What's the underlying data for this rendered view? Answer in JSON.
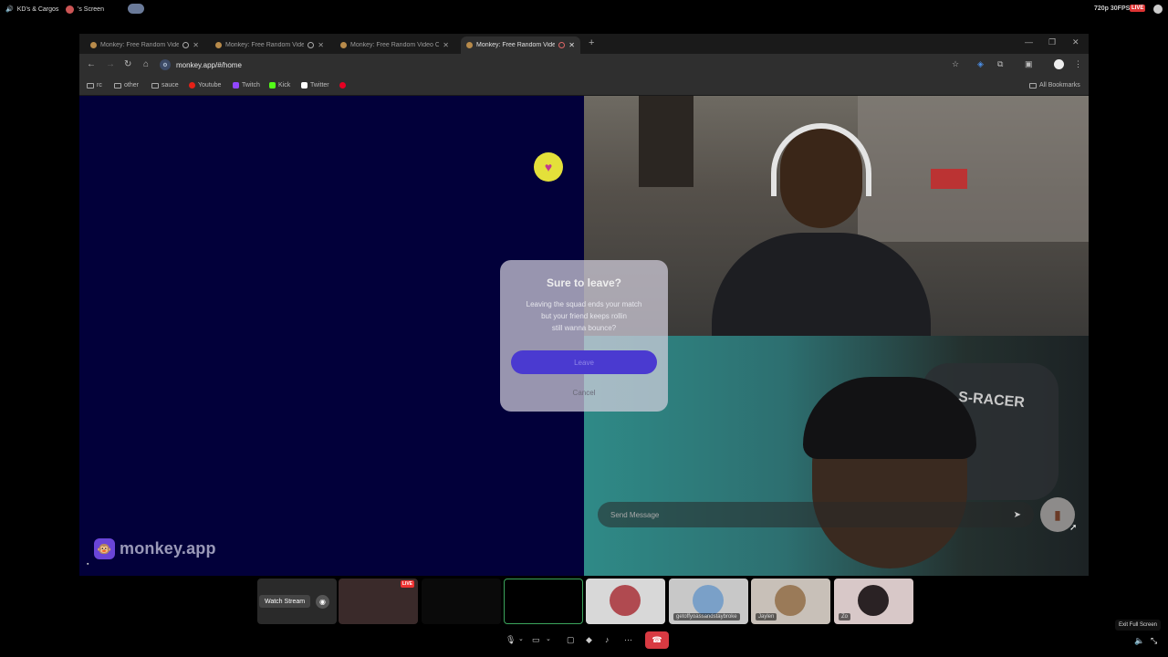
{
  "discord_top": {
    "channel": "KD's & Cargos",
    "screen_label": "'s Screen",
    "quality": "720p 30FPS",
    "live_badge": "LIVE"
  },
  "browser": {
    "tabs": [
      {
        "title": "Monkey: Free Random Video",
        "active": false
      },
      {
        "title": "Monkey: Free Random Video",
        "active": false
      },
      {
        "title": "Monkey: Free Random Video C",
        "active": false
      },
      {
        "title": "Monkey: Free Random Video",
        "active": true
      }
    ],
    "url": "monkey.app/#/home",
    "bookmarks": [
      {
        "label": "rc",
        "icon": "folder-icon"
      },
      {
        "label": "other",
        "icon": "folder-icon"
      },
      {
        "label": "sauce",
        "icon": "folder-icon"
      },
      {
        "label": "Youtube",
        "icon": "youtube-icon",
        "color": "#e62117"
      },
      {
        "label": "Twitch",
        "icon": "twitch-icon",
        "color": "#9146ff"
      },
      {
        "label": "Kick",
        "icon": "kick-icon",
        "color": "#53fc18"
      },
      {
        "label": "Twitter",
        "icon": "twitter-icon",
        "color": "#ffffff"
      },
      {
        "label": "",
        "icon": "pinterest-icon",
        "color": "#e60023"
      }
    ],
    "all_bookmarks": "All Bookmarks"
  },
  "monkey": {
    "brand": "monkey.app",
    "message_placeholder": "Send Message",
    "modal": {
      "title": "Sure to leave?",
      "body_line1": "Leaving the squad ends your match",
      "body_line2": "but your friend keeps rollin",
      "body_line3": "still wanna bounce?",
      "leave": "Leave",
      "cancel": "Cancel"
    },
    "video_bottom_text": "S-RACER"
  },
  "discord_bottom": {
    "watch_stream": "Watch Stream",
    "tile_live": "LIVE",
    "participants": [
      {
        "name": "",
        "color": "#b04a50"
      },
      {
        "name": "getoffyoassandstaybroke",
        "color": "#7aa0c8"
      },
      {
        "name": "Jaylen",
        "color": "#9a7a58"
      },
      {
        "name": "Zo",
        "color": "#2a2224"
      }
    ],
    "exit_fullscreen": "Exit Full Screen"
  },
  "colors": {
    "left_pane": "#02003a",
    "leave_button": "#4a3ad0",
    "hangup": "#d83a42"
  }
}
